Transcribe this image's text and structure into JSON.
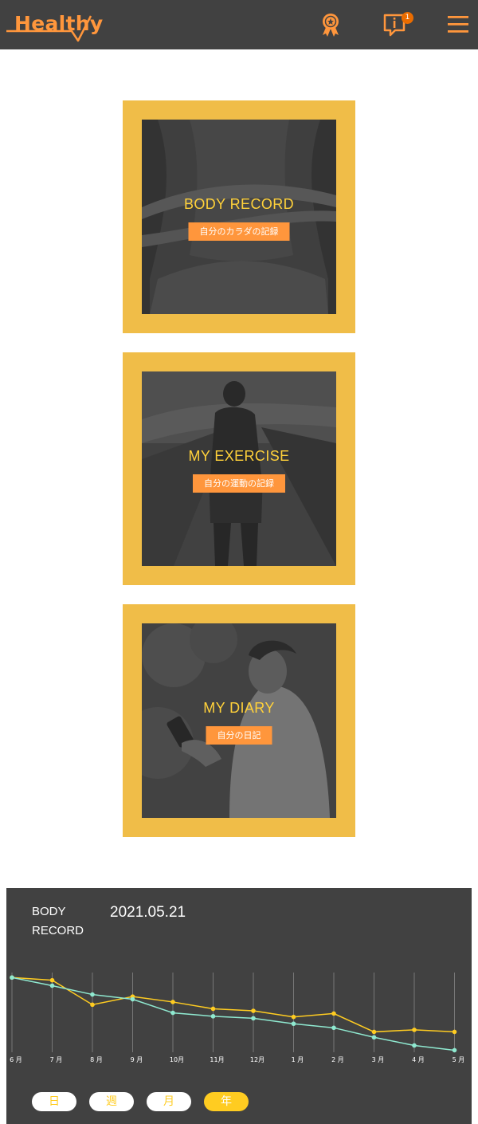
{
  "header": {
    "logo_text": "Healthy",
    "notification_count": "1",
    "colors": {
      "bg": "#414141",
      "accent": "#ff963c"
    },
    "icons": [
      "medal-icon",
      "info-chat-icon",
      "menu-icon"
    ]
  },
  "cards": [
    {
      "title": "BODY RECORD",
      "subtitle": "自分のカラダの記録"
    },
    {
      "title": "MY EXERCISE",
      "subtitle": "自分の運動の記録"
    },
    {
      "title": "MY DIARY",
      "subtitle": "自分の日記"
    }
  ],
  "body_record": {
    "label_line1": "BODY",
    "label_line2": "RECORD",
    "date": "2021.05.21",
    "tabs": [
      "日",
      "週",
      "月",
      "年"
    ],
    "active_tab": "年"
  },
  "chart_data": {
    "type": "line",
    "categories": [
      "6 月",
      "7 月",
      "8 月",
      "9 月",
      "10月",
      "11月",
      "12月",
      "1 月",
      "2 月",
      "3 月",
      "4 月",
      "5 月"
    ],
    "series": [
      {
        "color": "#ffcc21",
        "values": [
          100,
          96,
          60,
          72,
          64,
          54,
          51,
          42,
          47,
          20,
          23,
          20
        ]
      },
      {
        "color": "#8fe9d0",
        "values": [
          100,
          88,
          75,
          68,
          48,
          43,
          40,
          32,
          26,
          12,
          0,
          -7
        ]
      }
    ],
    "ylim": [
      -10,
      105
    ],
    "grid": true
  }
}
